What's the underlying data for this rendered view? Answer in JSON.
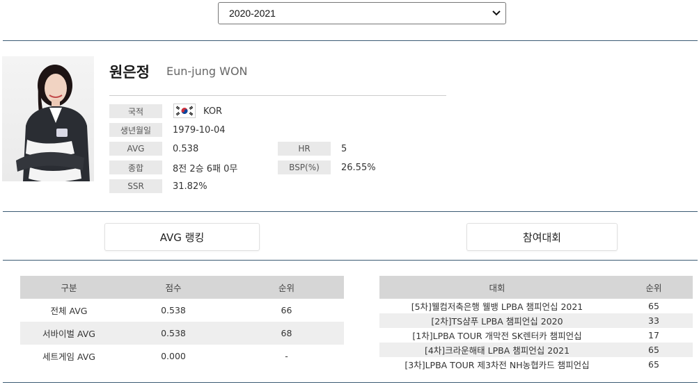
{
  "season_select": {
    "value": "2020-2021"
  },
  "player": {
    "name_ko": "원은정",
    "name_en": "Eun-jung WON",
    "photo_icon": "player-portrait",
    "flag_icon": "korea-flag-icon",
    "fields": {
      "nationality_label": "국적",
      "nationality_value": "KOR",
      "birth_label": "생년월일",
      "birth_value": "1979-10-04",
      "avg_label": "AVG",
      "avg_value": "0.538",
      "hr_label": "HR",
      "hr_value": "5",
      "record_label": "종합",
      "record_value": "8전 2승 6패 0무",
      "bsp_label": "BSP(%)",
      "bsp_value": "26.55%",
      "ssr_label": "SSR",
      "ssr_value": "31.82%"
    }
  },
  "tabs": {
    "avg_ranking": "AVG 랭킹",
    "tournaments": "참여대회"
  },
  "ranking_table": {
    "headers": [
      "구분",
      "점수",
      "순위"
    ],
    "rows": [
      [
        "전체 AVG",
        "0.538",
        "66"
      ],
      [
        "서바이벌 AVG",
        "0.538",
        "68"
      ],
      [
        "세트게임 AVG",
        "0.000",
        "-"
      ]
    ]
  },
  "tournament_table": {
    "headers": [
      "대회",
      "순위"
    ],
    "rows": [
      [
        "[5차]웰컴저축은행 웰뱅 LPBA 챔피언십 2021",
        "65"
      ],
      [
        "[2차]TS샴푸 LPBA 챔피언십 2020",
        "33"
      ],
      [
        "[1차]LPBA TOUR 개막전 SK렌터카 챔피언십",
        "17"
      ],
      [
        "[4차]크라운해태 LPBA 챔피언십 2021",
        "65"
      ],
      [
        "[3차]LPBA TOUR 제3차전 NH농협카드 챔피언십",
        "65"
      ]
    ]
  }
}
